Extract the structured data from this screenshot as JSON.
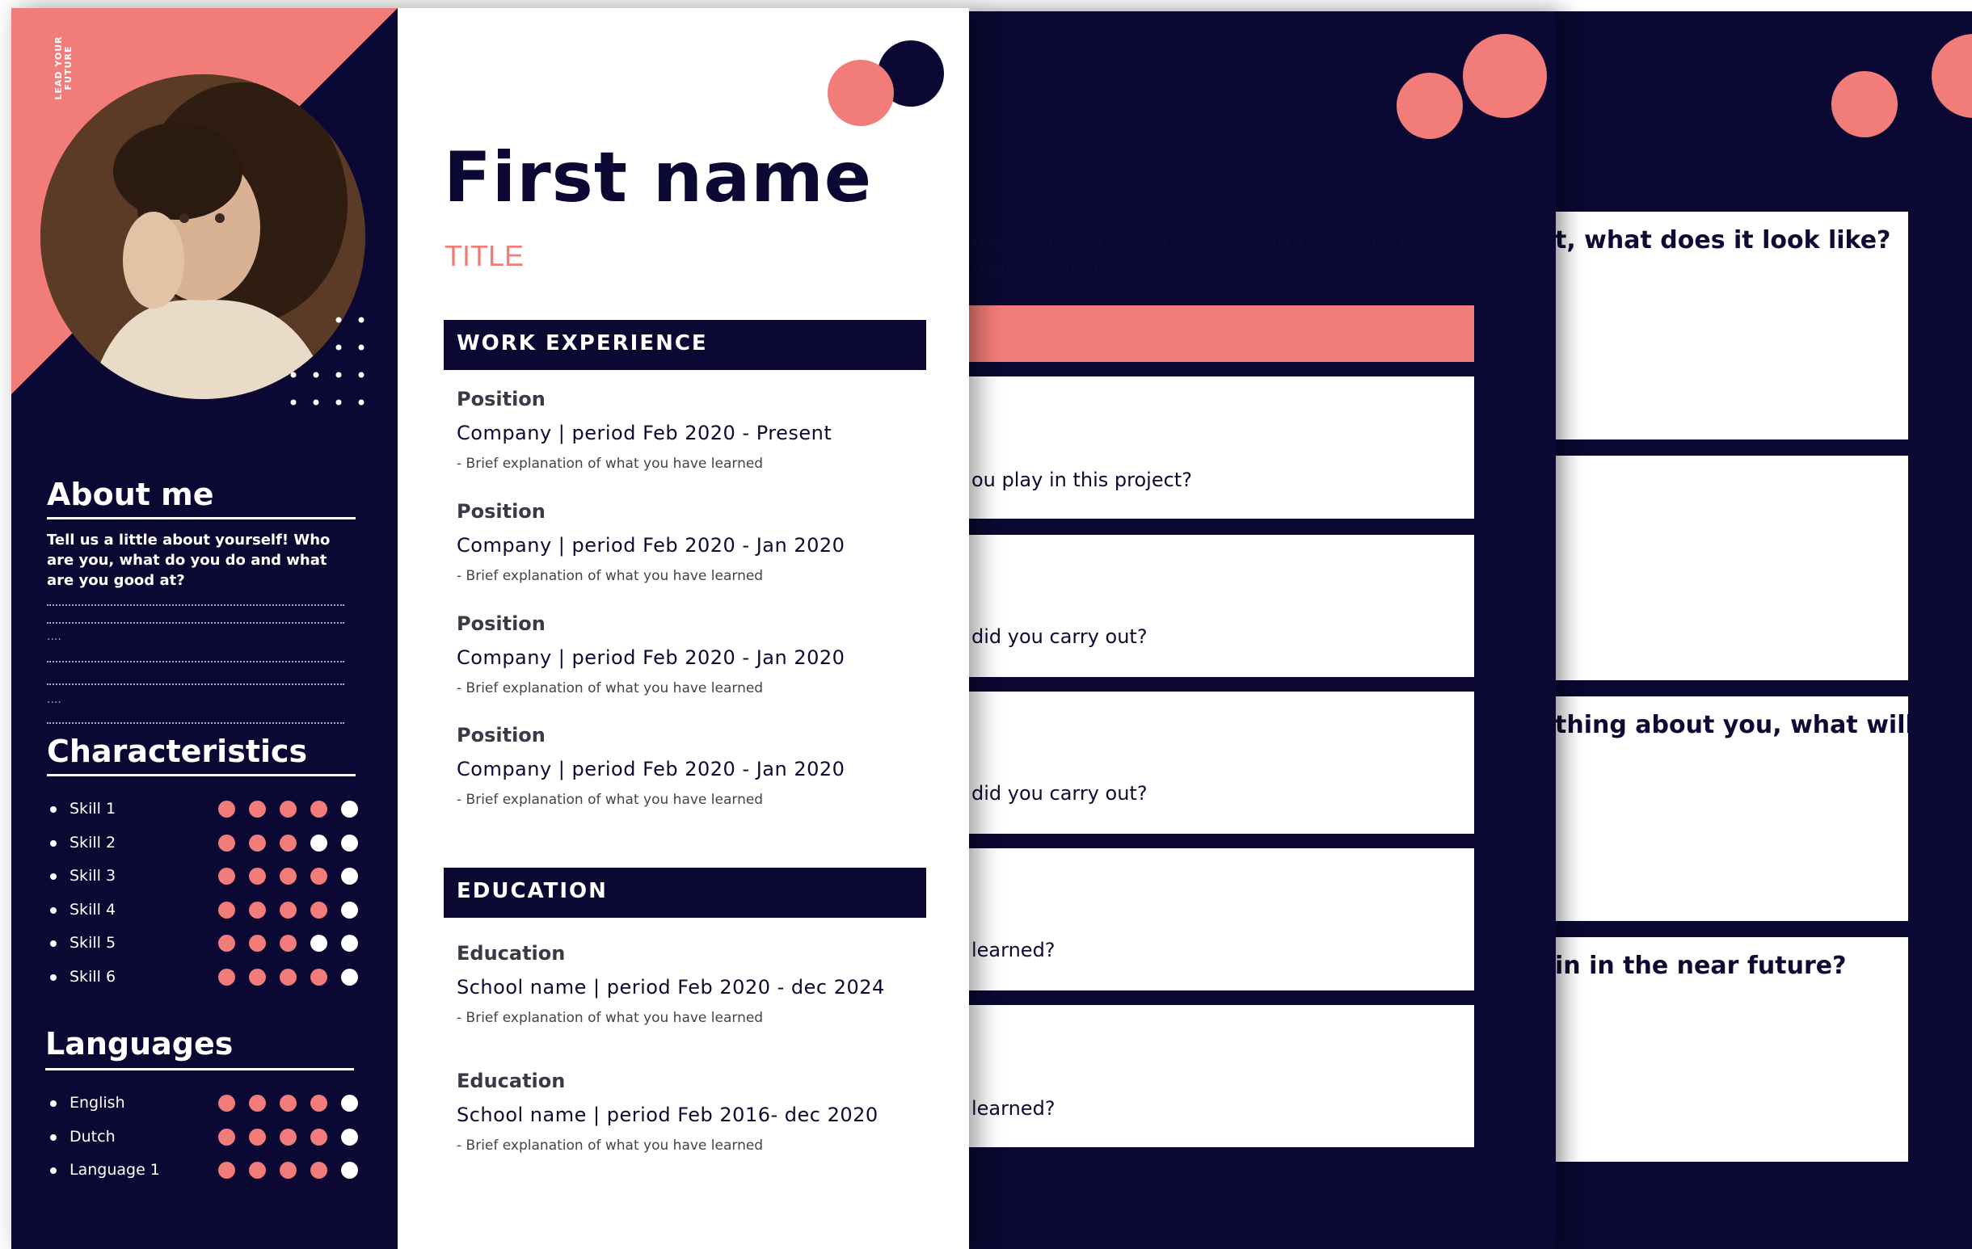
{
  "colors": {
    "navy": "#0b0833",
    "coral": "#f27c79",
    "white": "#ffffff"
  },
  "logo": {
    "text": "LEAD YOUR FUTURE"
  },
  "profile": {
    "name": "First name",
    "title": "TITLE",
    "photo": "portrait-photo"
  },
  "about": {
    "heading": "About me",
    "text_lines": [
      "Tell us a little about yourself! Who",
      "are you, what do you do and what",
      "are you good at?"
    ],
    "filler_short": "....",
    "filler_short2": "...."
  },
  "characteristics": {
    "heading": "Characteristics",
    "skills": [
      {
        "label": "Skill 1",
        "rating": 4
      },
      {
        "label": "Skill 2",
        "rating": 3
      },
      {
        "label": "Skill 3",
        "rating": 4
      },
      {
        "label": "Skill 4",
        "rating": 4
      },
      {
        "label": "Skill 5",
        "rating": 3
      },
      {
        "label": "Skill 6",
        "rating": 4
      }
    ]
  },
  "languages": {
    "heading": "Languages",
    "items": [
      {
        "label": "English",
        "rating": 4
      },
      {
        "label": "Dutch",
        "rating": 4
      },
      {
        "label": "Language 1",
        "rating": 4
      }
    ]
  },
  "work": {
    "heading": "WORK EXPERIENCE",
    "entries": [
      {
        "position": "Position",
        "line": "Company | period Feb 2020 - Present",
        "note": "- Brief explanation of what you have learned"
      },
      {
        "position": "Position",
        "line": "Company | period Feb 2020 - Jan 2020",
        "note": "- Brief explanation of what you have learned"
      },
      {
        "position": "Position",
        "line": "Company | period Feb 2020 - Jan 2020",
        "note": "- Brief explanation of what you have learned"
      },
      {
        "position": "Position",
        "line": "Company | period Feb 2020 - Jan 2020",
        "note": "- Brief explanation of what you have learned"
      }
    ]
  },
  "education": {
    "heading": "EDUCATION",
    "entries": [
      {
        "position": "Education",
        "line": "School name | period Feb 2020 - dec 2024",
        "note": "- Brief explanation of what you have learned"
      },
      {
        "position": "Education",
        "line": "School name | period Feb 2016- dec 2020",
        "note": "- Brief explanation of what you have learned"
      }
    ]
  },
  "page2": {
    "intro_lines": [
      "n various cases, projects and investigations at",
      "ded several masterclasses and workshops."
    ],
    "questions": [
      "ou play in this project?",
      "did you carry out?",
      "did you carry out?",
      "learned?",
      "learned?"
    ]
  },
  "page3": {
    "questions": [
      "t, what does it look like?",
      "thing about you, what will",
      "in in the near future?"
    ]
  }
}
